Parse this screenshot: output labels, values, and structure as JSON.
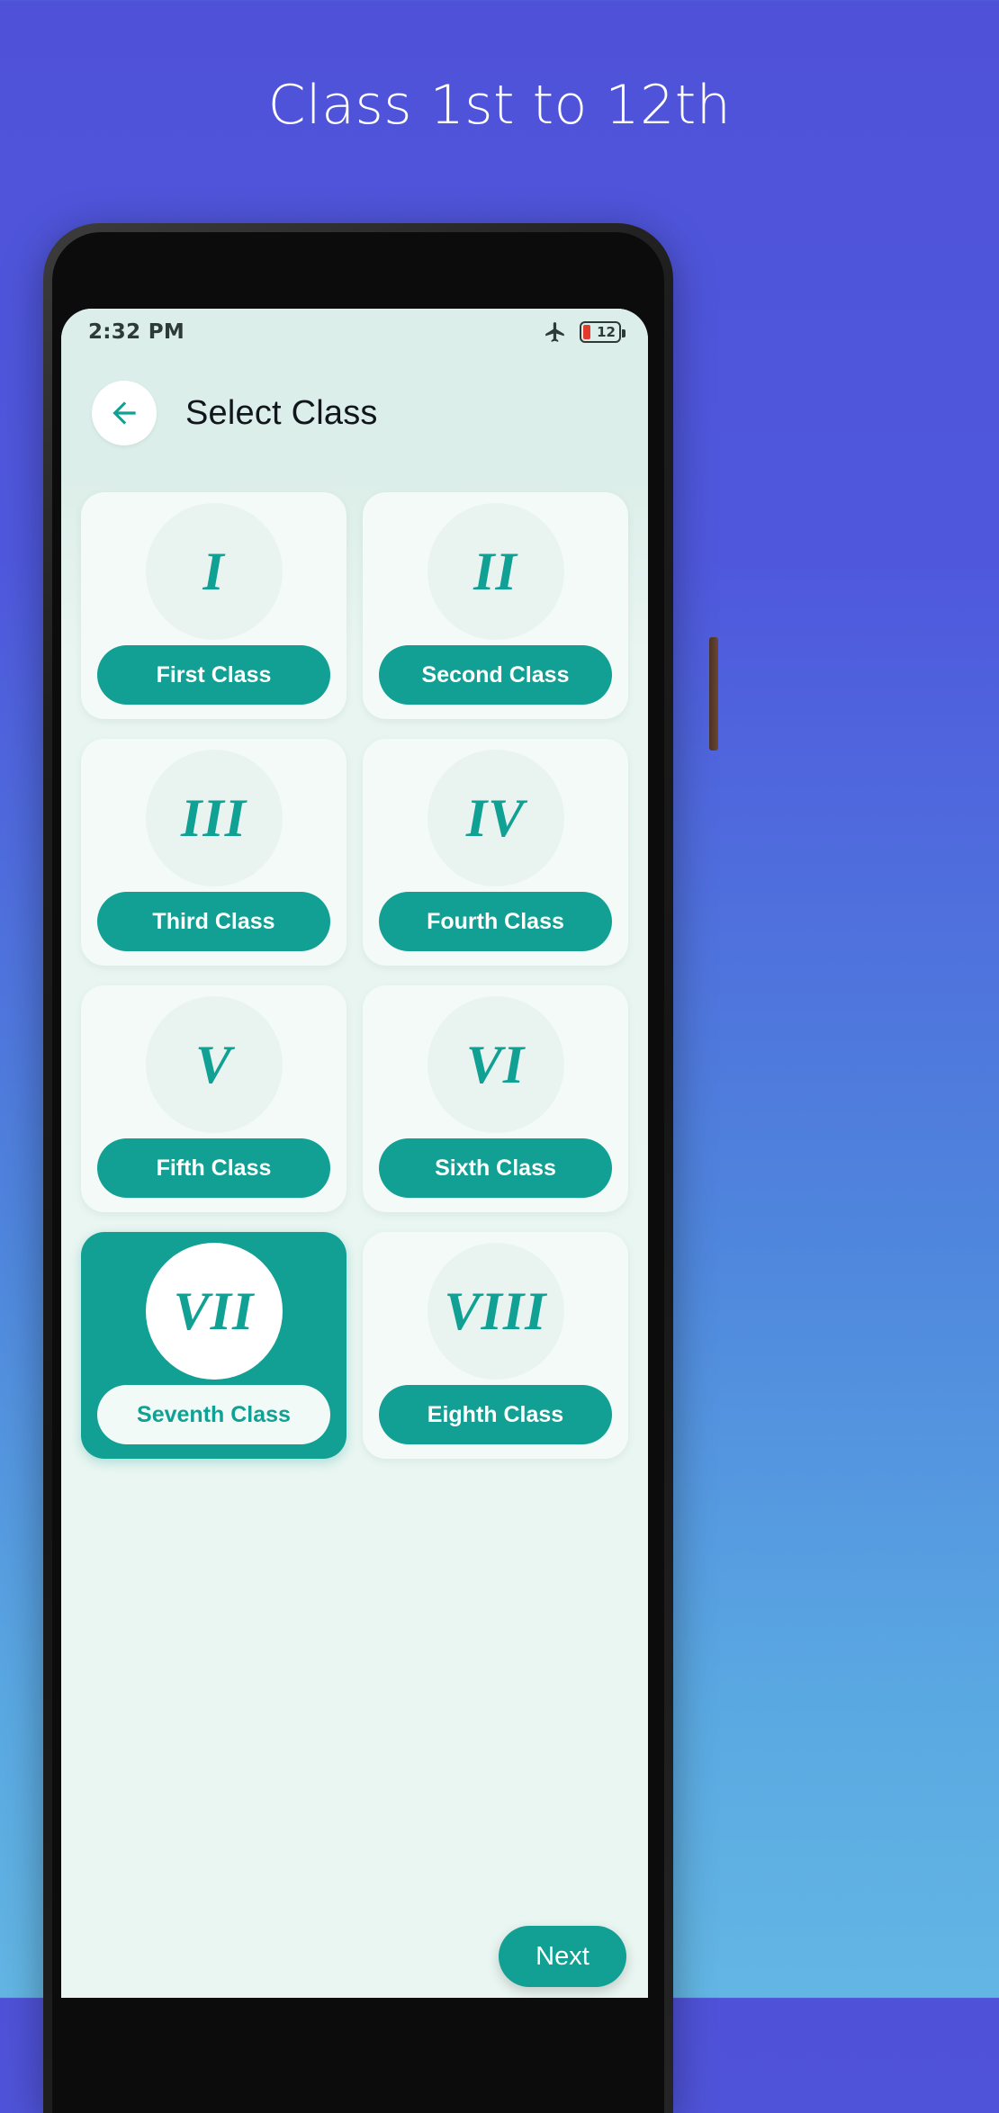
{
  "promo": {
    "title": "Class 1st to 12th"
  },
  "statusbar": {
    "time": "2:32 PM",
    "airplane_icon": "airplane-mode-icon",
    "battery_level": "12",
    "battery_icon": "battery-low-icon"
  },
  "appbar": {
    "back_icon": "arrow-left-icon",
    "title": "Select Class"
  },
  "colors": {
    "accent_teal": "#11a093",
    "card_bg": "#f3faf7",
    "screen_bg": "#eaf6f2",
    "appbar_bg": "#dbeeea",
    "promo_bg_top": "#4f52d8",
    "promo_bg_bottom": "#63b6e4",
    "battery_red": "#e23b2e"
  },
  "classes": [
    {
      "numeral": "I",
      "label": "First Class",
      "selected": false
    },
    {
      "numeral": "II",
      "label": "Second Class",
      "selected": false
    },
    {
      "numeral": "III",
      "label": "Third Class",
      "selected": false
    },
    {
      "numeral": "IV",
      "label": "Fourth Class",
      "selected": false
    },
    {
      "numeral": "V",
      "label": "Fifth Class",
      "selected": false
    },
    {
      "numeral": "VI",
      "label": "Sixth Class",
      "selected": false
    },
    {
      "numeral": "VII",
      "label": "Seventh Class",
      "selected": true
    },
    {
      "numeral": "VIII",
      "label": "Eighth Class",
      "selected": false
    }
  ],
  "fab": {
    "label": "Next"
  }
}
